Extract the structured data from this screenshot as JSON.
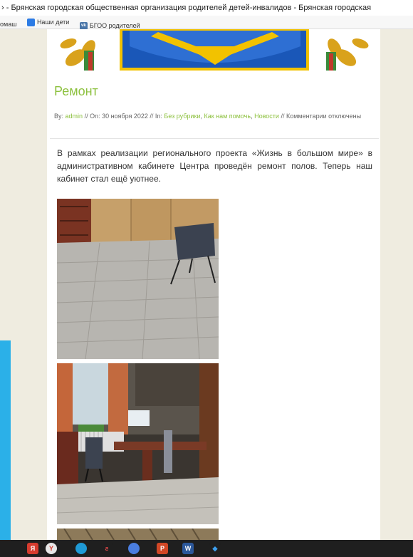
{
  "browser": {
    "window_title": "› - Брянская городская общественная организация родителей детей-инвалидов - Брянская городская",
    "bookmarks": [
      {
        "label": "омаш",
        "icon": "folder-icon"
      },
      {
        "label": "Наши дети",
        "icon": "chat-icon"
      },
      {
        "label": "БГОО родителей",
        "icon": "vk-icon"
      }
    ]
  },
  "post": {
    "title": "Ремонт",
    "meta": {
      "by_label": "By:",
      "author": "admin",
      "on_label": "// On: 30 ноября 2022 // In:",
      "cat1": "Без рубрики",
      "sep1": ",",
      "cat2": "Как нам помочь",
      "sep2": ",",
      "cat3": "Новости",
      "comments": "// Комментарии отключены"
    },
    "text": "В рамках реализации регионального проекта «Жизнь в большом мире» в административном кабинете Центра проведён ремонт полов. Теперь наш кабинет стал ещё уютнее."
  },
  "colors": {
    "accent_green": "#8dc13f",
    "taskbar": "#1f1f1f",
    "page_bg": "#efece0"
  },
  "taskbar": {
    "icons": [
      "yandex-browser-icon",
      "yandex-icon",
      "edge-icon",
      "pinned-app-icon",
      "chrome-icon",
      "powerpoint-icon",
      "word-icon",
      "other-app-icon"
    ]
  }
}
